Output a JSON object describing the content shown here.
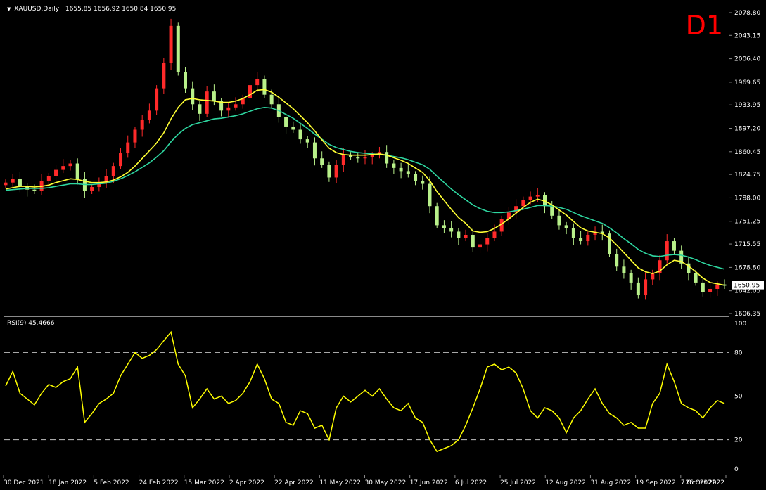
{
  "header": {
    "symbol_line": "XAUUSD,Daily",
    "ohlc": "1655.85 1656.92 1650.84 1650.95",
    "timeframe_label": "D1"
  },
  "price_axis": {
    "ticks": [
      "2078.80",
      "2043.15",
      "2006.40",
      "1969.65",
      "1933.95",
      "1897.20",
      "1860.45",
      "1824.75",
      "1788.00",
      "1751.25",
      "1715.55",
      "1678.80",
      "1642.05",
      "1606.35"
    ],
    "current_price": "1650.95"
  },
  "rsi": {
    "title": "RSI(9) 45.4666",
    "ticks": [
      "100",
      "80",
      "50",
      "20",
      "0"
    ],
    "levels": [
      80,
      50,
      20
    ]
  },
  "time_axis": {
    "labels": [
      "30 Dec 2021",
      "18 Jan 2022",
      "5 Feb 2022",
      "24 Feb 2022",
      "15 Mar 2022",
      "2 Apr 2022",
      "22 Apr 2022",
      "11 May 2022",
      "30 May 2022",
      "17 Jun 2022",
      "6 Jul 2022",
      "25 Jul 2022",
      "12 Aug 2022",
      "31 Aug 2022",
      "19 Sep 2022",
      "7 Oct 2022",
      "26 Oct 2022"
    ]
  },
  "colors": {
    "bull": "#ff2a2a",
    "bear": "#b8f08a",
    "ma_fast": "#ffff33",
    "ma_slow": "#2ed6a0",
    "rsi_line": "#ffff00",
    "level_line": "#c0c0c0",
    "tf_label": "#ff0000"
  },
  "chart_data": [
    {
      "type": "line",
      "chart": "candlestick price with moving averages",
      "x_labels": [
        "30 Dec 2021",
        "18 Jan 2022",
        "5 Feb 2022",
        "24 Feb 2022",
        "15 Mar 2022",
        "2 Apr 2022",
        "22 Apr 2022",
        "11 May 2022",
        "30 May 2022",
        "17 Jun 2022",
        "6 Jul 2022",
        "25 Jul 2022",
        "12 Aug 2022",
        "31 Aug 2022",
        "19 Sep 2022",
        "7 Oct 2022",
        "26 Oct 2022"
      ],
      "close": [
        1812,
        1818,
        1806,
        1801,
        1799,
        1815,
        1822,
        1832,
        1838,
        1842,
        1818,
        1799,
        1805,
        1812,
        1822,
        1838,
        1858,
        1875,
        1895,
        1910,
        1925,
        1960,
        2000,
        2058,
        1985,
        1960,
        1935,
        1920,
        1955,
        1940,
        1925,
        1930,
        1935,
        1945,
        1965,
        1975,
        1950,
        1935,
        1915,
        1900,
        1895,
        1880,
        1875,
        1850,
        1840,
        1820,
        1840,
        1855,
        1852,
        1850,
        1852,
        1855,
        1860,
        1842,
        1835,
        1830,
        1825,
        1815,
        1810,
        1775,
        1745,
        1740,
        1735,
        1725,
        1730,
        1710,
        1715,
        1725,
        1735,
        1755,
        1765,
        1775,
        1785,
        1790,
        1792,
        1775,
        1760,
        1745,
        1740,
        1725,
        1720,
        1730,
        1735,
        1732,
        1700,
        1680,
        1670,
        1655,
        1635,
        1660,
        1670,
        1690,
        1720,
        1705,
        1685,
        1670,
        1655,
        1640,
        1645,
        1652,
        1650
      ],
      "ma_fast": [
        1802,
        1804,
        1806,
        1806,
        1805,
        1806,
        1808,
        1812,
        1815,
        1818,
        1817,
        1814,
        1812,
        1812,
        1813,
        1816,
        1821,
        1828,
        1838,
        1850,
        1862,
        1874,
        1890,
        1912,
        1930,
        1942,
        1944,
        1942,
        1941,
        1940,
        1938,
        1938,
        1940,
        1944,
        1950,
        1957,
        1958,
        1954,
        1946,
        1937,
        1928,
        1917,
        1906,
        1893,
        1879,
        1866,
        1859,
        1856,
        1855,
        1855,
        1855,
        1856,
        1857,
        1855,
        1851,
        1847,
        1842,
        1835,
        1828,
        1815,
        1798,
        1784,
        1770,
        1757,
        1748,
        1736,
        1734,
        1735,
        1740,
        1747,
        1755,
        1764,
        1773,
        1781,
        1786,
        1783,
        1777,
        1769,
        1761,
        1751,
        1741,
        1736,
        1734,
        1732,
        1725,
        1714,
        1702,
        1690,
        1678,
        1672,
        1669,
        1673,
        1683,
        1690,
        1688,
        1681,
        1672,
        1662,
        1655,
        1653,
        1651
      ],
      "ma_slow": [
        1800,
        1801,
        1802,
        1803,
        1803,
        1803,
        1804,
        1806,
        1808,
        1810,
        1810,
        1809,
        1809,
        1810,
        1811,
        1814,
        1818,
        1823,
        1829,
        1836,
        1843,
        1852,
        1862,
        1876,
        1888,
        1897,
        1903,
        1906,
        1909,
        1912,
        1913,
        1915,
        1917,
        1920,
        1924,
        1928,
        1930,
        1929,
        1925,
        1919,
        1913,
        1905,
        1897,
        1888,
        1880,
        1872,
        1867,
        1864,
        1861,
        1859,
        1858,
        1857,
        1856,
        1855,
        1853,
        1851,
        1848,
        1844,
        1840,
        1833,
        1822,
        1812,
        1802,
        1793,
        1785,
        1777,
        1771,
        1767,
        1765,
        1765,
        1766,
        1768,
        1770,
        1773,
        1776,
        1776,
        1775,
        1773,
        1770,
        1765,
        1760,
        1756,
        1752,
        1748,
        1741,
        1733,
        1724,
        1716,
        1707,
        1701,
        1697,
        1696,
        1698,
        1699,
        1698,
        1695,
        1691,
        1686,
        1682,
        1679,
        1676
      ]
    },
    {
      "type": "line",
      "chart": "RSI(9)",
      "ylim": [
        0,
        100
      ],
      "levels": [
        80,
        50,
        20
      ],
      "values": [
        57,
        67,
        52,
        48,
        44,
        52,
        58,
        56,
        60,
        62,
        70,
        32,
        38,
        45,
        48,
        52,
        64,
        72,
        80,
        76,
        78,
        82,
        88,
        94,
        72,
        64,
        42,
        48,
        55,
        48,
        50,
        45,
        47,
        52,
        60,
        72,
        62,
        48,
        45,
        32,
        30,
        40,
        38,
        28,
        30,
        20,
        42,
        50,
        46,
        50,
        54,
        50,
        55,
        48,
        42,
        40,
        45,
        35,
        32,
        20,
        12,
        14,
        16,
        20,
        30,
        42,
        55,
        70,
        72,
        68,
        70,
        66,
        55,
        40,
        35,
        42,
        40,
        35,
        25,
        35,
        40,
        48,
        55,
        45,
        38,
        35,
        30,
        32,
        28,
        28,
        45,
        52,
        72,
        60,
        45,
        42,
        40,
        35,
        42,
        47,
        45
      ]
    }
  ]
}
